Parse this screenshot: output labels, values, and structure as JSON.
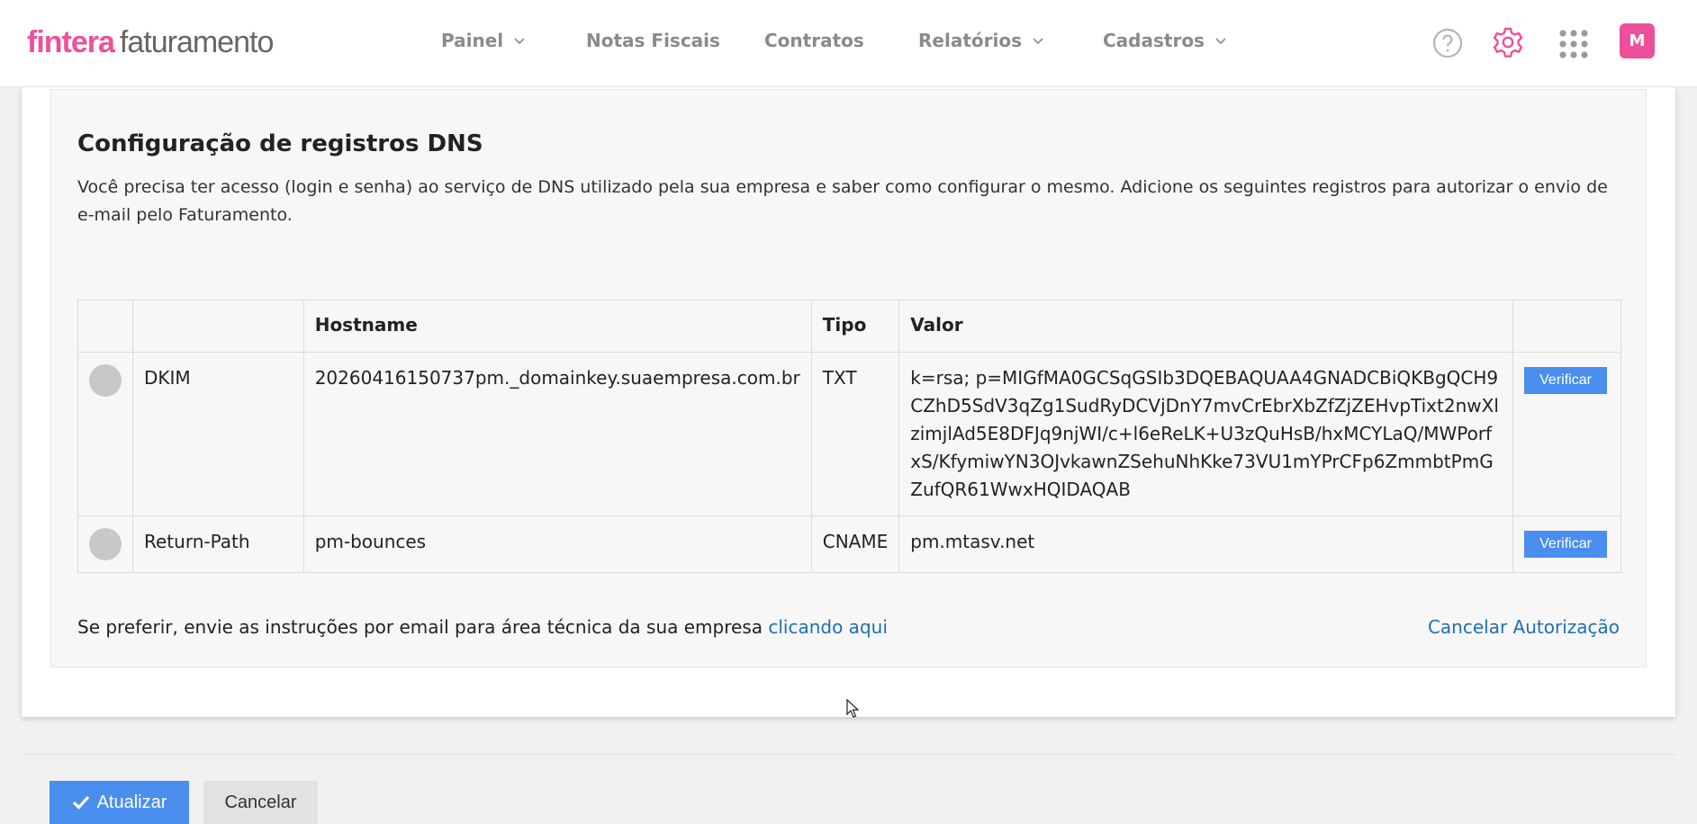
{
  "header": {
    "logo_brand": "fintera",
    "logo_product": "faturamento",
    "nav": [
      "Painel",
      "Notas Fiscais",
      "Contratos",
      "Relatórios",
      "Cadastros"
    ],
    "avatar_initial": "M",
    "accent_color": "#ee4f9b"
  },
  "dns": {
    "title": "Configuração de registros DNS",
    "description": "Você precisa ter acesso (login e senha) ao serviço de DNS utilizado pela sua empresa e saber como configurar o mesmo. Adicione os seguintes registros para autorizar o envio de e-mail pelo Faturamento.",
    "columns": [
      "",
      "",
      "Hostname",
      "Tipo",
      "Valor",
      ""
    ],
    "rows": [
      {
        "name": "DKIM",
        "hostname": "20260416150737pm._domainkey.suaempresa.com.br",
        "type": "TXT",
        "value": "k=rsa; p=MIGfMA0GCSqGSIb3DQEBAQUAA4GNADCBiQKBgQCH9CZhD5SdV3qZg1SudRyDCVjDnY7mvCrEbrXbZfZjZEHvpTixt2nwXlzimjlAd5E8DFJq9njWI/c+l6eReLK+U3zQuHsB/hxMCYLaQ/MWPorfxS/KfymiwYN3OJvkawnZSehuNhKke73VU1mYPrCFp6ZmmbtPmGZufQR61WwxHQIDAQAB",
        "action": "Verificar"
      },
      {
        "name": "Return-Path",
        "hostname": "pm-bounces",
        "type": "CNAME",
        "value": "pm.mtasv.net",
        "action": "Verificar"
      }
    ],
    "footer_text": "Se preferir, envie as instruções por email para área técnica da sua empresa ",
    "footer_link": "clicando aqui",
    "cancel_link": "Cancelar Autorização"
  },
  "actions": {
    "update": "Atualizar",
    "cancel": "Cancelar",
    "primary_color": "#4a8ef0"
  }
}
